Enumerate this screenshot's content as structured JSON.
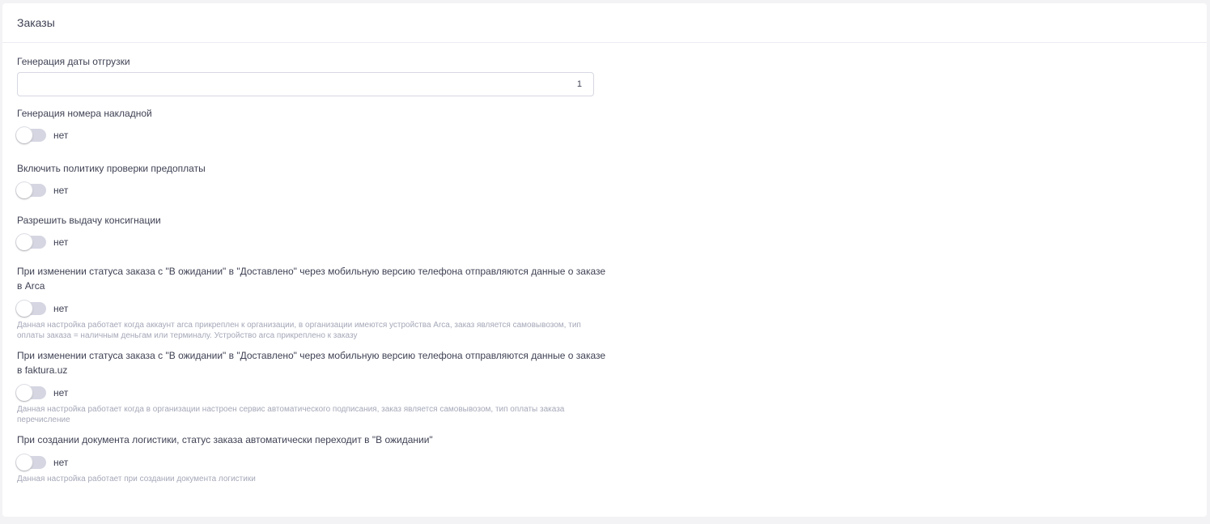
{
  "card": {
    "title": "Заказы"
  },
  "shipping_date": {
    "label": "Генерация даты отгрузки",
    "value": "1"
  },
  "settings": [
    {
      "label": "Генерация номера накладной",
      "state_text": "нет",
      "enabled": false,
      "hint": ""
    },
    {
      "label": "Включить политику проверки предоплаты",
      "state_text": "нет",
      "enabled": false,
      "hint": ""
    },
    {
      "label": "Разрешить выдачу консигнации",
      "state_text": "нет",
      "enabled": false,
      "hint": ""
    },
    {
      "label": "При изменении статуса заказа с \"В ожидании\" в \"Доставлено\" через мобильную версию телефона отправляются данные о заказе в Arca",
      "state_text": "нет",
      "enabled": false,
      "hint": "Данная настройка работает когда аккаунт arca прикреплен к организации, в организации имеются устройства Arca, заказ является самовывозом, тип оплаты заказа = наличным деньгам или терминалу. Устройство arca прикреплено к заказу"
    },
    {
      "label": "При изменении статуса заказа с \"В ожидании\" в \"Доставлено\" через мобильную версию телефона отправляются данные о заказе в faktura.uz",
      "state_text": "нет",
      "enabled": false,
      "hint": "Данная настройка работает когда в организации настроен сервис автоматического подписания, заказ является самовывозом, тип оплаты заказа перечисление"
    },
    {
      "label": "При создании документа логистики, статус заказа автоматически переходит в \"В ожидании\"",
      "state_text": "нет",
      "enabled": false,
      "hint": "Данная настройка работает при создании документа логистики"
    }
  ],
  "colors": {
    "toggle_off": "#d5d6e2",
    "hint_text": "#a5a8b8",
    "label_text": "#3f4254"
  }
}
